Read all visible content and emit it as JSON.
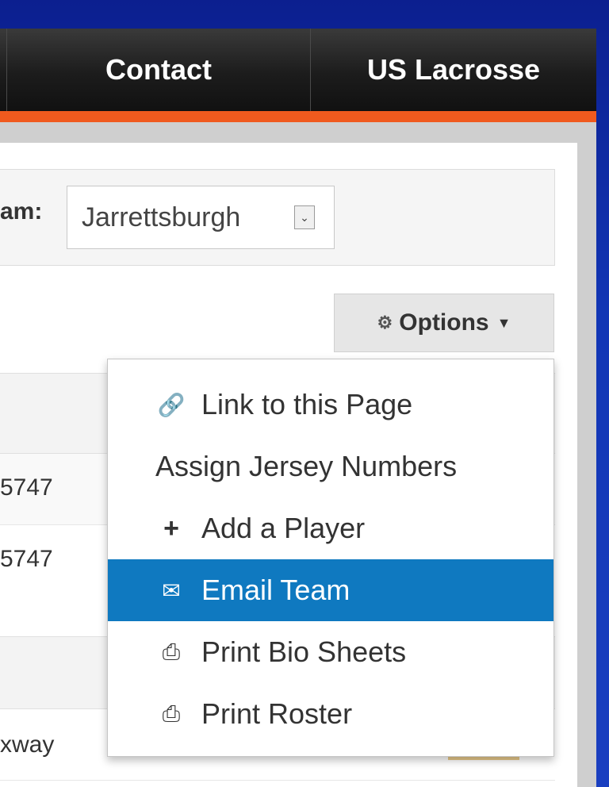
{
  "navbar": {
    "items": [
      {
        "label": "Contact"
      },
      {
        "label": "US Lacrosse"
      }
    ]
  },
  "team_selector": {
    "label": "am:",
    "selected": "Jarrettsburgh"
  },
  "options_button": {
    "label": "Options",
    "icon": "gears-icon"
  },
  "table": {
    "rows": [
      {
        "cell": "5747"
      },
      {
        "cell": "5747"
      },
      {
        "cell": "xway"
      }
    ]
  },
  "dropdown": {
    "items": [
      {
        "label": "Link to this Page",
        "icon": "link-icon"
      },
      {
        "label": "Assign Jersey Numbers",
        "icon": ""
      },
      {
        "label": "Add a Player",
        "icon": "plus-icon"
      },
      {
        "label": "Email Team",
        "icon": "envelope-icon"
      },
      {
        "label": "Print Bio Sheets",
        "icon": "printer-icon"
      },
      {
        "label": "Print Roster",
        "icon": "printer-icon"
      }
    ],
    "active_index": 3
  },
  "colors": {
    "nav_bg": "#1c1c1c",
    "accent_orange": "#f05a1e",
    "active_blue": "#0f79c0",
    "backdrop_blue": "#1236b5"
  }
}
